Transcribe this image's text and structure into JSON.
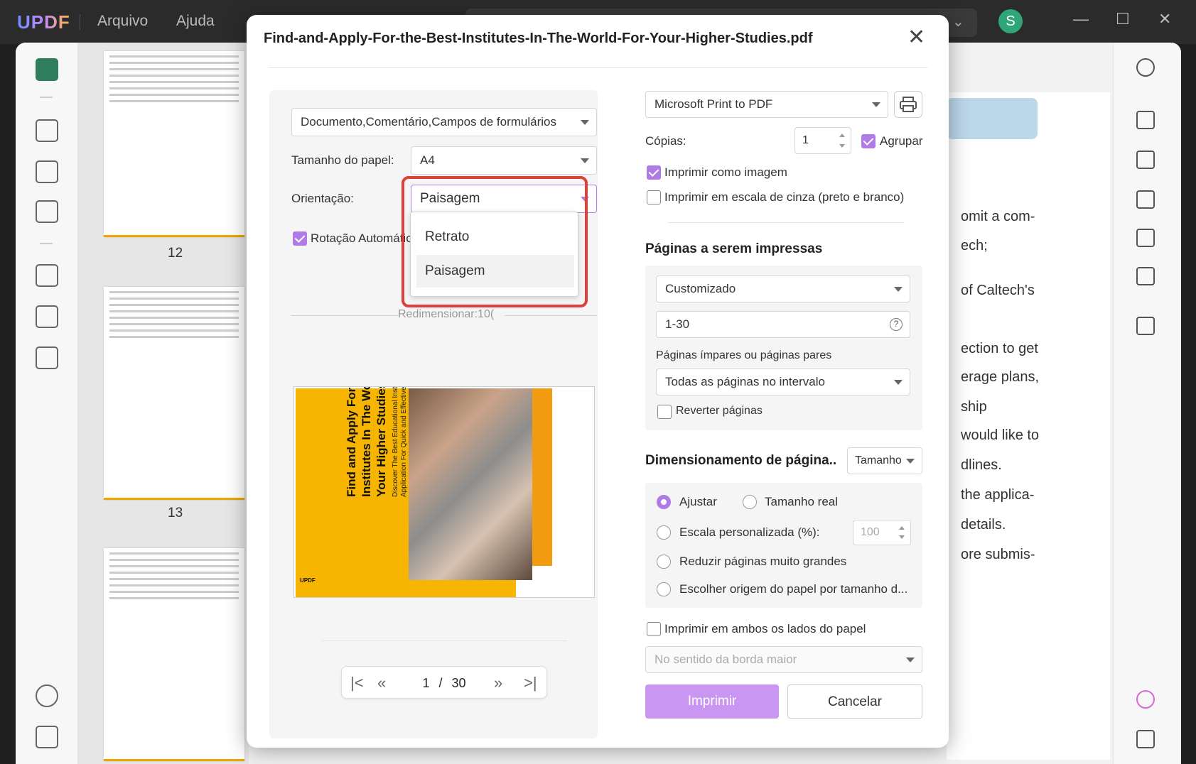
{
  "app": {
    "logo": "UPDF",
    "menu": [
      "Arquivo",
      "Ajuda"
    ],
    "avatar_letter": "S"
  },
  "thumbnails": {
    "pages": [
      "12",
      "13"
    ]
  },
  "document_text": [
    "omit a com-",
    "ech;",
    "of Caltech's",
    "ection to get",
    "erage plans,",
    "ship",
    "would like to",
    "dlines.",
    "the applica-",
    "details.",
    "ore submis-"
  ],
  "dialog": {
    "title": "Find-and-Apply-For-the-Best-Institutes-In-The-World-For-Your-Higher-Studies.pdf",
    "close_icon": "close-icon",
    "content_select": "Documento,Comentário,Campos de formulários",
    "paper_size_label": "Tamanho do papel:",
    "paper_size_value": "A4",
    "orientation_label": "Orientação:",
    "orientation_value": "Paisagem",
    "orientation_options": [
      "Retrato",
      "Paisagem"
    ],
    "auto_rotate_label": "Rotação Automátic",
    "resize_label": "Redimensionar:10(",
    "preview": {
      "title": "Find and Apply For the Best Institutes In The World For Your Higher Studies",
      "subtitle": "Discover The Best Educational Institute and Digitize Your Application For Quick and Effective Results",
      "logo": "UPDF"
    },
    "pager": {
      "current": "1",
      "separator": "/",
      "total": "30"
    },
    "printer": "Microsoft Print to PDF",
    "copies_label": "Cópias:",
    "copies_value": "1",
    "collate_label": "Agrupar",
    "print_as_image_label": "Imprimir como imagem",
    "grayscale_label": "Imprimir em escala de cinza (preto e branco)",
    "pages_section_title": "Páginas a serem impressas",
    "pages_mode": "Customizado",
    "pages_range": "1-30",
    "odd_even_label": "Páginas ímpares ou páginas pares",
    "odd_even_value": "Todas as páginas no intervalo",
    "reverse_label": "Reverter páginas",
    "sizing_section_title": "Dimensionamento de página..",
    "sizing_mode": "Tamanho",
    "fit_label": "Ajustar",
    "actual_size_label": "Tamanho real",
    "custom_scale_label": "Escala personalizada (%):",
    "custom_scale_value": "100",
    "shrink_label": "Reduzir páginas muito grandes",
    "paper_source_label": "Escolher origem do papel por tamanho d...",
    "duplex_label": "Imprimir em ambos os lados do papel",
    "duplex_edge": "No sentido da borda maior",
    "print_button": "Imprimir",
    "cancel_button": "Cancelar"
  },
  "colors": {
    "accent": "#b07be6",
    "highlight": "#e0403a",
    "brand_green": "#2e7d5b"
  }
}
